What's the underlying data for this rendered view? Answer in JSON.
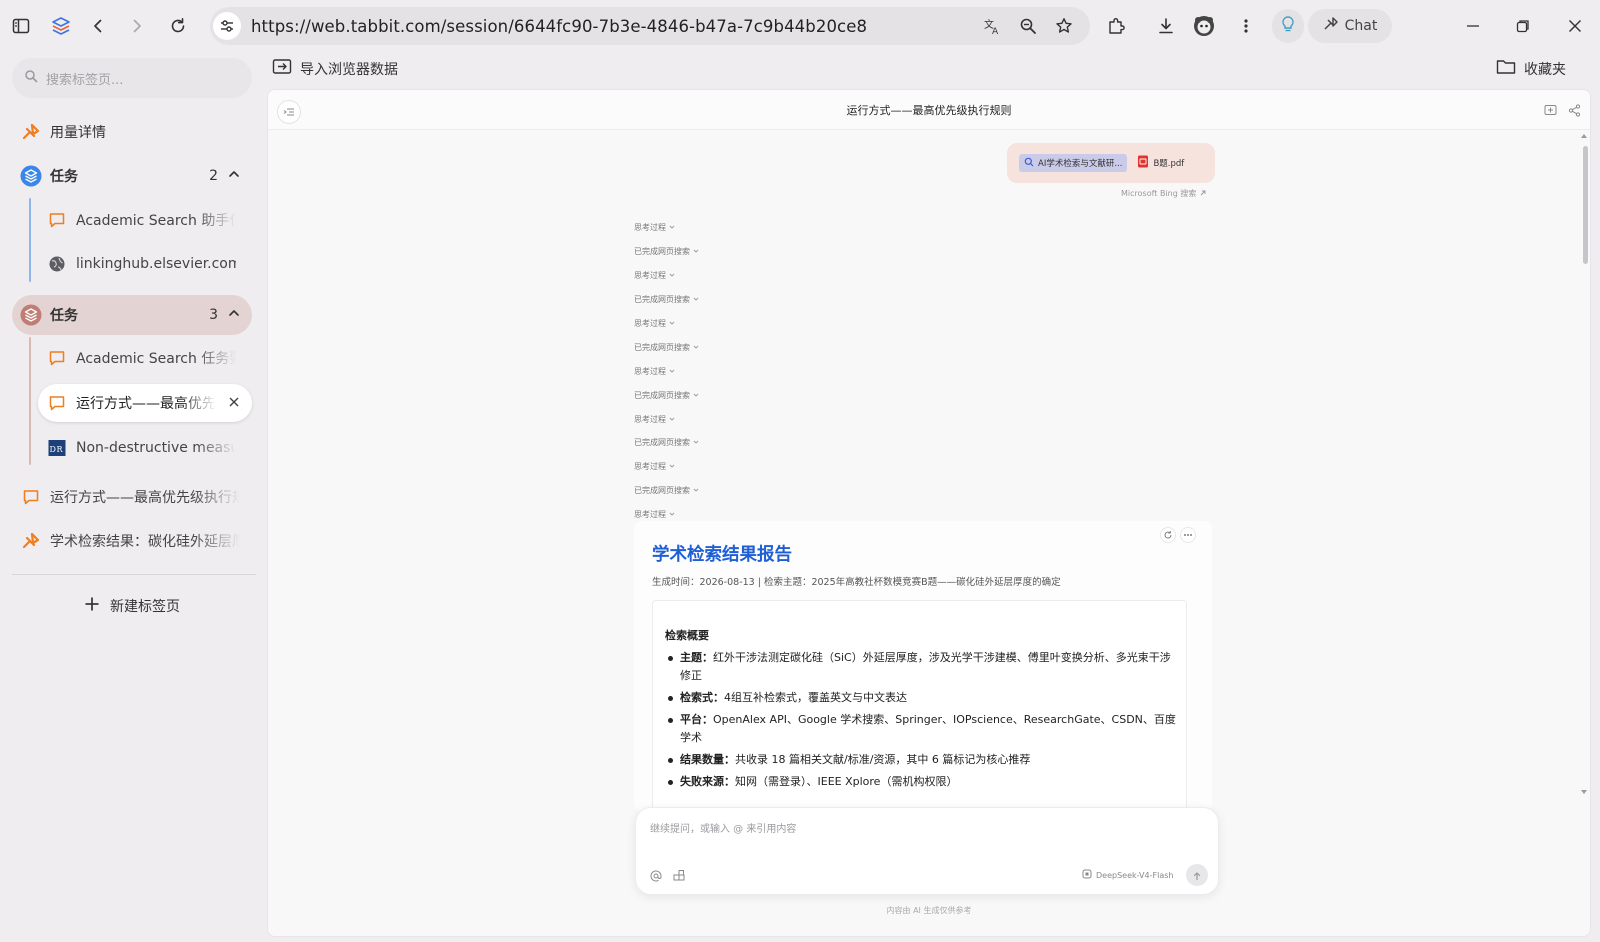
{
  "browser": {
    "url": "https://web.tabbit.com/session/6644fc90-7b3e-4846-b47a-7c9b44b20ce8",
    "chat_label": "Chat",
    "import_label": "导入浏览器数据",
    "bookmarks_label": "收藏夹"
  },
  "sidebar": {
    "search_placeholder": "搜索标签页...",
    "usage_label": "用量详情",
    "group1": {
      "title": "任务",
      "count": "2",
      "items": [
        {
          "label": "Academic Search 助手任务"
        },
        {
          "label": "linkinghub.elsevier.com"
        }
      ]
    },
    "group2": {
      "title": "任务",
      "count": "3",
      "items": [
        {
          "label": "Academic Search 任务要求"
        },
        {
          "label": "运行方式——最高优先级"
        },
        {
          "label": "Non-destructive measurement"
        }
      ]
    },
    "loose_items": [
      {
        "label": "运行方式——最高优先级执行规则"
      },
      {
        "label": "学术检索结果：碳化硅外延层厚度"
      }
    ],
    "new_tab_label": "新建标签页",
    "colors": {
      "accent": "#f07d1f",
      "group1_line": "#8fb6e8",
      "group2_line": "#d9b9b4"
    }
  },
  "panel": {
    "title": "运行方式——最高优先级执行规则",
    "user_message": {
      "attachment_search": "AI学术检索与文献研...",
      "attachment_pdf": "B题.pdf"
    },
    "bing_note": "Microsoft Bing 搜索",
    "steps": [
      "思考过程",
      "已完成网页搜索",
      "思考过程",
      "已完成网页搜索",
      "思考过程",
      "已完成网页搜索",
      "思考过程",
      "已完成网页搜索",
      "思考过程",
      "已完成网页搜索",
      "思考过程",
      "已完成网页搜索",
      "思考过程"
    ],
    "report": {
      "title": "学术检索结果报告",
      "meta": "生成时间：2026-08-13 | 检索主题：2025年高教社杯数模竞赛B题——碳化硅外延层厚度的确定",
      "summary_title": "检索概要",
      "items": [
        {
          "key": "主题：",
          "text": "红外干涉法测定碳化硅（SiC）外延层厚度，涉及光学干涉建模、傅里叶变换分析、多光束干涉修正"
        },
        {
          "key": "检索式：",
          "text": "4组互补检索式，覆盖英文与中文表达"
        },
        {
          "key": "平台：",
          "text": "OpenAlex API、Google 学术搜索、Springer、IOPscience、ResearchGate、CSDN、百度学术"
        },
        {
          "key": "结果数量：",
          "text": "共收录 18 篇相关文献/标准/资源，其中 6 篇标记为核心推荐"
        },
        {
          "key": "失败来源：",
          "text": "知网（需登录）、IEEE Xplore（需机构权限）"
        }
      ]
    },
    "composer": {
      "placeholder": "继续提问，或输入 @ 来引用内容",
      "model": "DeepSeek-V4-Flash"
    },
    "disclaimer": "内容由 AI 生成仅供参考"
  }
}
